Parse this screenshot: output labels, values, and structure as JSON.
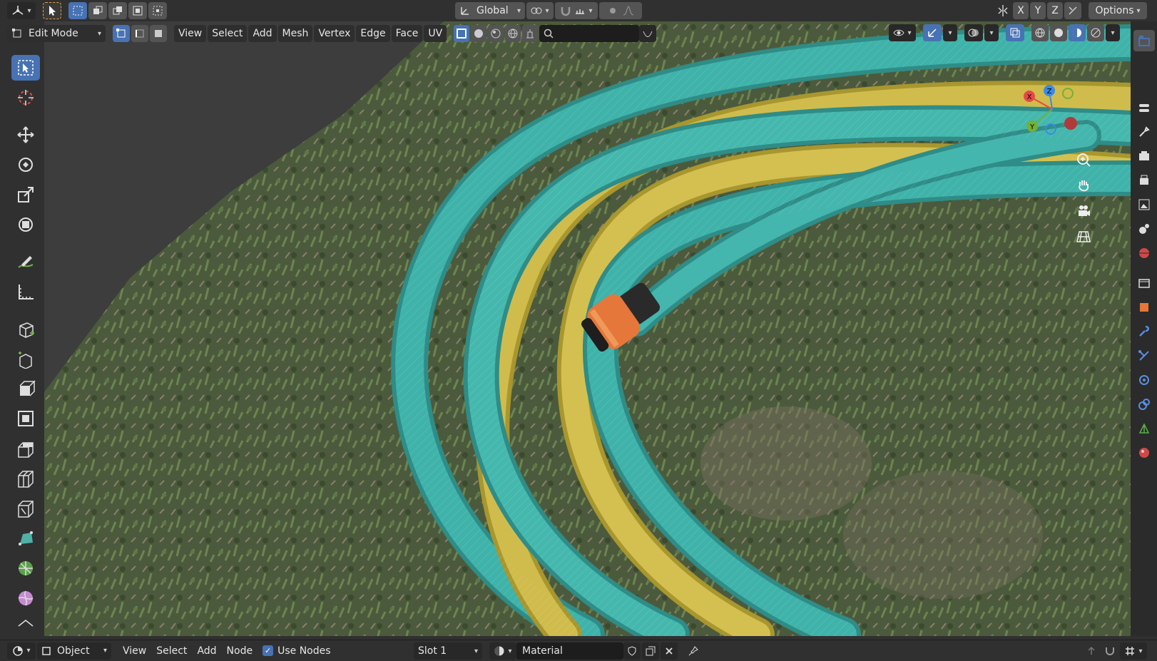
{
  "top_header": {
    "transform_orientation": "Global",
    "axis_labels": [
      "X",
      "Y",
      "Z"
    ],
    "options_label": "Options"
  },
  "view_header": {
    "mode": "Edit Mode",
    "menus": [
      "View",
      "Select",
      "Add",
      "Mesh",
      "Vertex",
      "Edge",
      "Face",
      "UV"
    ],
    "search_placeholder": ""
  },
  "toolbar": {
    "tools": [
      "select-box-icon",
      "cursor-icon",
      "move-icon",
      "rotate-icon",
      "scale-icon",
      "transform-icon",
      "annotate-icon",
      "measure-icon",
      "add-cube-icon",
      "extrude-region-icon",
      "extrude-individual-icon",
      "inset-faces-icon",
      "bevel-icon",
      "loop-cut-icon",
      "knife-icon",
      "poly-build-icon",
      "spin-icon",
      "smooth-icon",
      "shrink-fatten-icon"
    ]
  },
  "gizmo": {
    "x_label": "X",
    "y_label": "Y",
    "z_label": "Z",
    "x_color": "#e64848",
    "y_color": "#74b038",
    "z_color": "#3a8ae6"
  },
  "bottom_header": {
    "editor_type": "Object",
    "menus": [
      "View",
      "Select",
      "Add",
      "Node"
    ],
    "use_nodes_label": "Use Nodes",
    "use_nodes_checked": true,
    "slot": "Slot 1",
    "material_name": "Material"
  },
  "colors": {
    "accent": "#4772b3",
    "header_bg": "#303030",
    "button_bg": "#545454",
    "hose_teal": "#3aa8a0",
    "hose_yellow": "#c9b544",
    "grass": "#4a5e3a",
    "connector_orange": "#e5773a"
  }
}
